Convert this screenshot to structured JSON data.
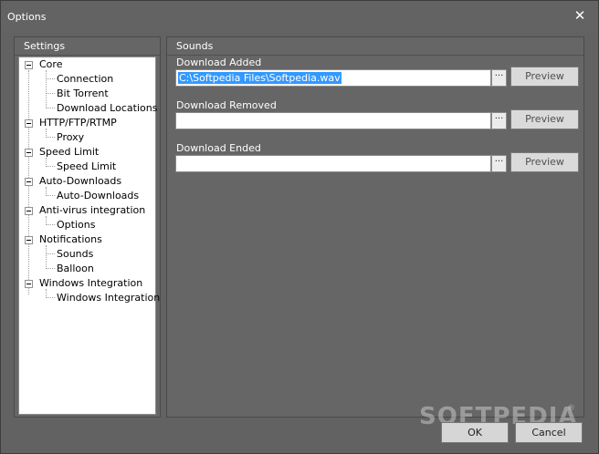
{
  "window": {
    "title": "Options",
    "close_glyph": "✕"
  },
  "settings": {
    "header": "Settings",
    "tree": [
      {
        "label": "Core",
        "children": [
          "Connection",
          "Bit Torrent",
          "Download Locations"
        ]
      },
      {
        "label": "HTTP/FTP/RTMP",
        "children": [
          "Proxy"
        ]
      },
      {
        "label": "Speed Limit",
        "children": [
          "Speed Limit"
        ]
      },
      {
        "label": "Auto-Downloads",
        "children": [
          "Auto-Downloads"
        ]
      },
      {
        "label": "Anti-virus integration",
        "children": [
          "Options"
        ]
      },
      {
        "label": "Notifications",
        "children": [
          "Sounds",
          "Balloon"
        ]
      },
      {
        "label": "Windows Integration",
        "children": [
          "Windows Integration"
        ]
      }
    ]
  },
  "sounds": {
    "header": "Sounds",
    "fields": [
      {
        "label": "Download Added",
        "value": "C:\\Softpedia Files\\Softpedia.wav",
        "browse": "···",
        "preview": "Preview"
      },
      {
        "label": "Download Removed",
        "value": "",
        "browse": "···",
        "preview": "Preview"
      },
      {
        "label": "Download Ended",
        "value": "",
        "browse": "···",
        "preview": "Preview"
      }
    ]
  },
  "buttons": {
    "ok": "OK",
    "cancel": "Cancel"
  },
  "watermark": {
    "text": "SOFTPEDIA",
    "reg": "®"
  }
}
